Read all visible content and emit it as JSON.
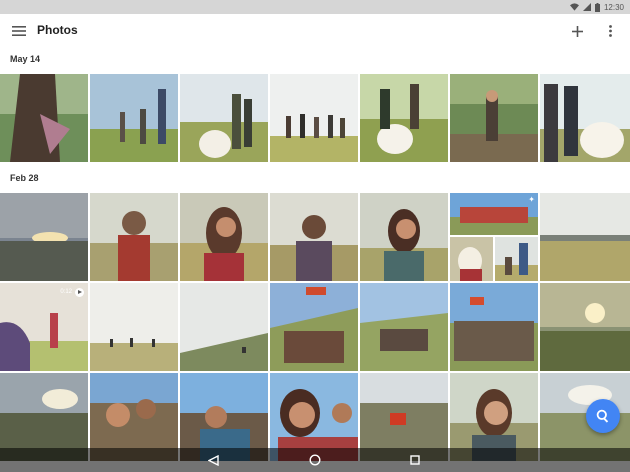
{
  "status": {
    "time": "12:30"
  },
  "app_bar": {
    "title": "Photos",
    "menu_icon": "hamburger-menu-icon",
    "add_icon": "plus-icon",
    "more_icon": "more-vert-icon"
  },
  "sections": [
    {
      "date": "May 14"
    },
    {
      "date": "Feb 28"
    }
  ],
  "video": {
    "duration": "0:12"
  },
  "fab": {
    "icon": "search-icon",
    "color": "#4285f4"
  },
  "nav": {
    "back_icon": "nav-back-icon",
    "home_icon": "nav-home-icon",
    "recents_icon": "nav-recents-icon"
  }
}
